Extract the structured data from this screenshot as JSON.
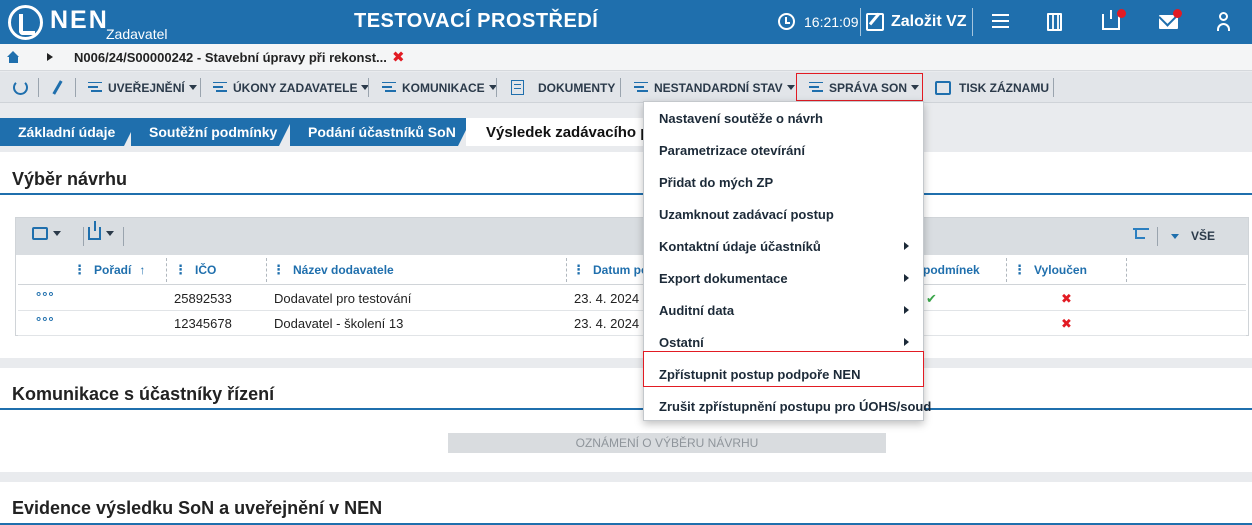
{
  "header": {
    "brand": "NEN",
    "brand_sub": "Zadavatel",
    "env_title": "TESTOVACÍ PROSTŘEDÍ",
    "clock": "16:21:09",
    "new_vz_label": "Založit VZ",
    "accent_color": "#1f6fad",
    "notification_color": "#e21b23"
  },
  "breadcrumb": {
    "text": "N006/24/S00000242 - Stavební úpravy při rekonst...",
    "close_glyph": "✖"
  },
  "toolbar": {
    "uverejneni": "UVEŘEJNĚNÍ",
    "ukony": "ÚKONY ZADAVATELE",
    "komunikace": "KOMUNIKACE",
    "dokumenty": "DOKUMENTY",
    "nestandardni": "NESTANDARDNÍ STAV",
    "sprava_son": "SPRÁVA SON",
    "tisk": "TISK ZÁZNAMU"
  },
  "tabs": {
    "t1": "Základní údaje",
    "t2": "Soutěžní podmínky",
    "t3": "Podání účastníků SoN",
    "active": "Výsledek zadávacího po"
  },
  "section1": {
    "title": "Výběr návrhu",
    "filter_all": "VŠE",
    "columns": {
      "poradi": "Pořadí",
      "sort_arrow": "↑",
      "ico": "IČO",
      "nazev": "Název dodavatele",
      "datum": "Datum pod",
      "podminek": "podmínek",
      "vyloucen": "Vyloučen"
    },
    "rows": [
      {
        "menu": "°°°",
        "ico": "25892533",
        "nazev": "Dodavatel pro testování",
        "datum": "23. 4. 2024",
        "podminek": "✔",
        "vyloucen": "✖"
      },
      {
        "menu": "°°°",
        "ico": "12345678",
        "nazev": "Dodavatel - školení 13",
        "datum": "23. 4. 2024",
        "podminek": "",
        "vyloucen": "✖"
      }
    ]
  },
  "section2": {
    "title": "Komunikace s účastníky řízení",
    "announce_button": "OZNÁMENÍ O VÝBĚRU NÁVRHU"
  },
  "section3": {
    "title": "Evidence výsledku SoN a uveřejnění v NEN"
  },
  "dropdown": {
    "items": [
      "Nastavení soutěže o návrh",
      "Parametrizace otevírání",
      "Přidat do mých ZP",
      "Uzamknout zadávací postup",
      "Kontaktní údaje účastníků",
      "Export dokumentace",
      "Auditní data",
      "Ostatní",
      "Zpřístupnit postup podpoře NEN",
      "Zrušit zpřístupnění postupu pro ÚOHS/soud"
    ]
  }
}
